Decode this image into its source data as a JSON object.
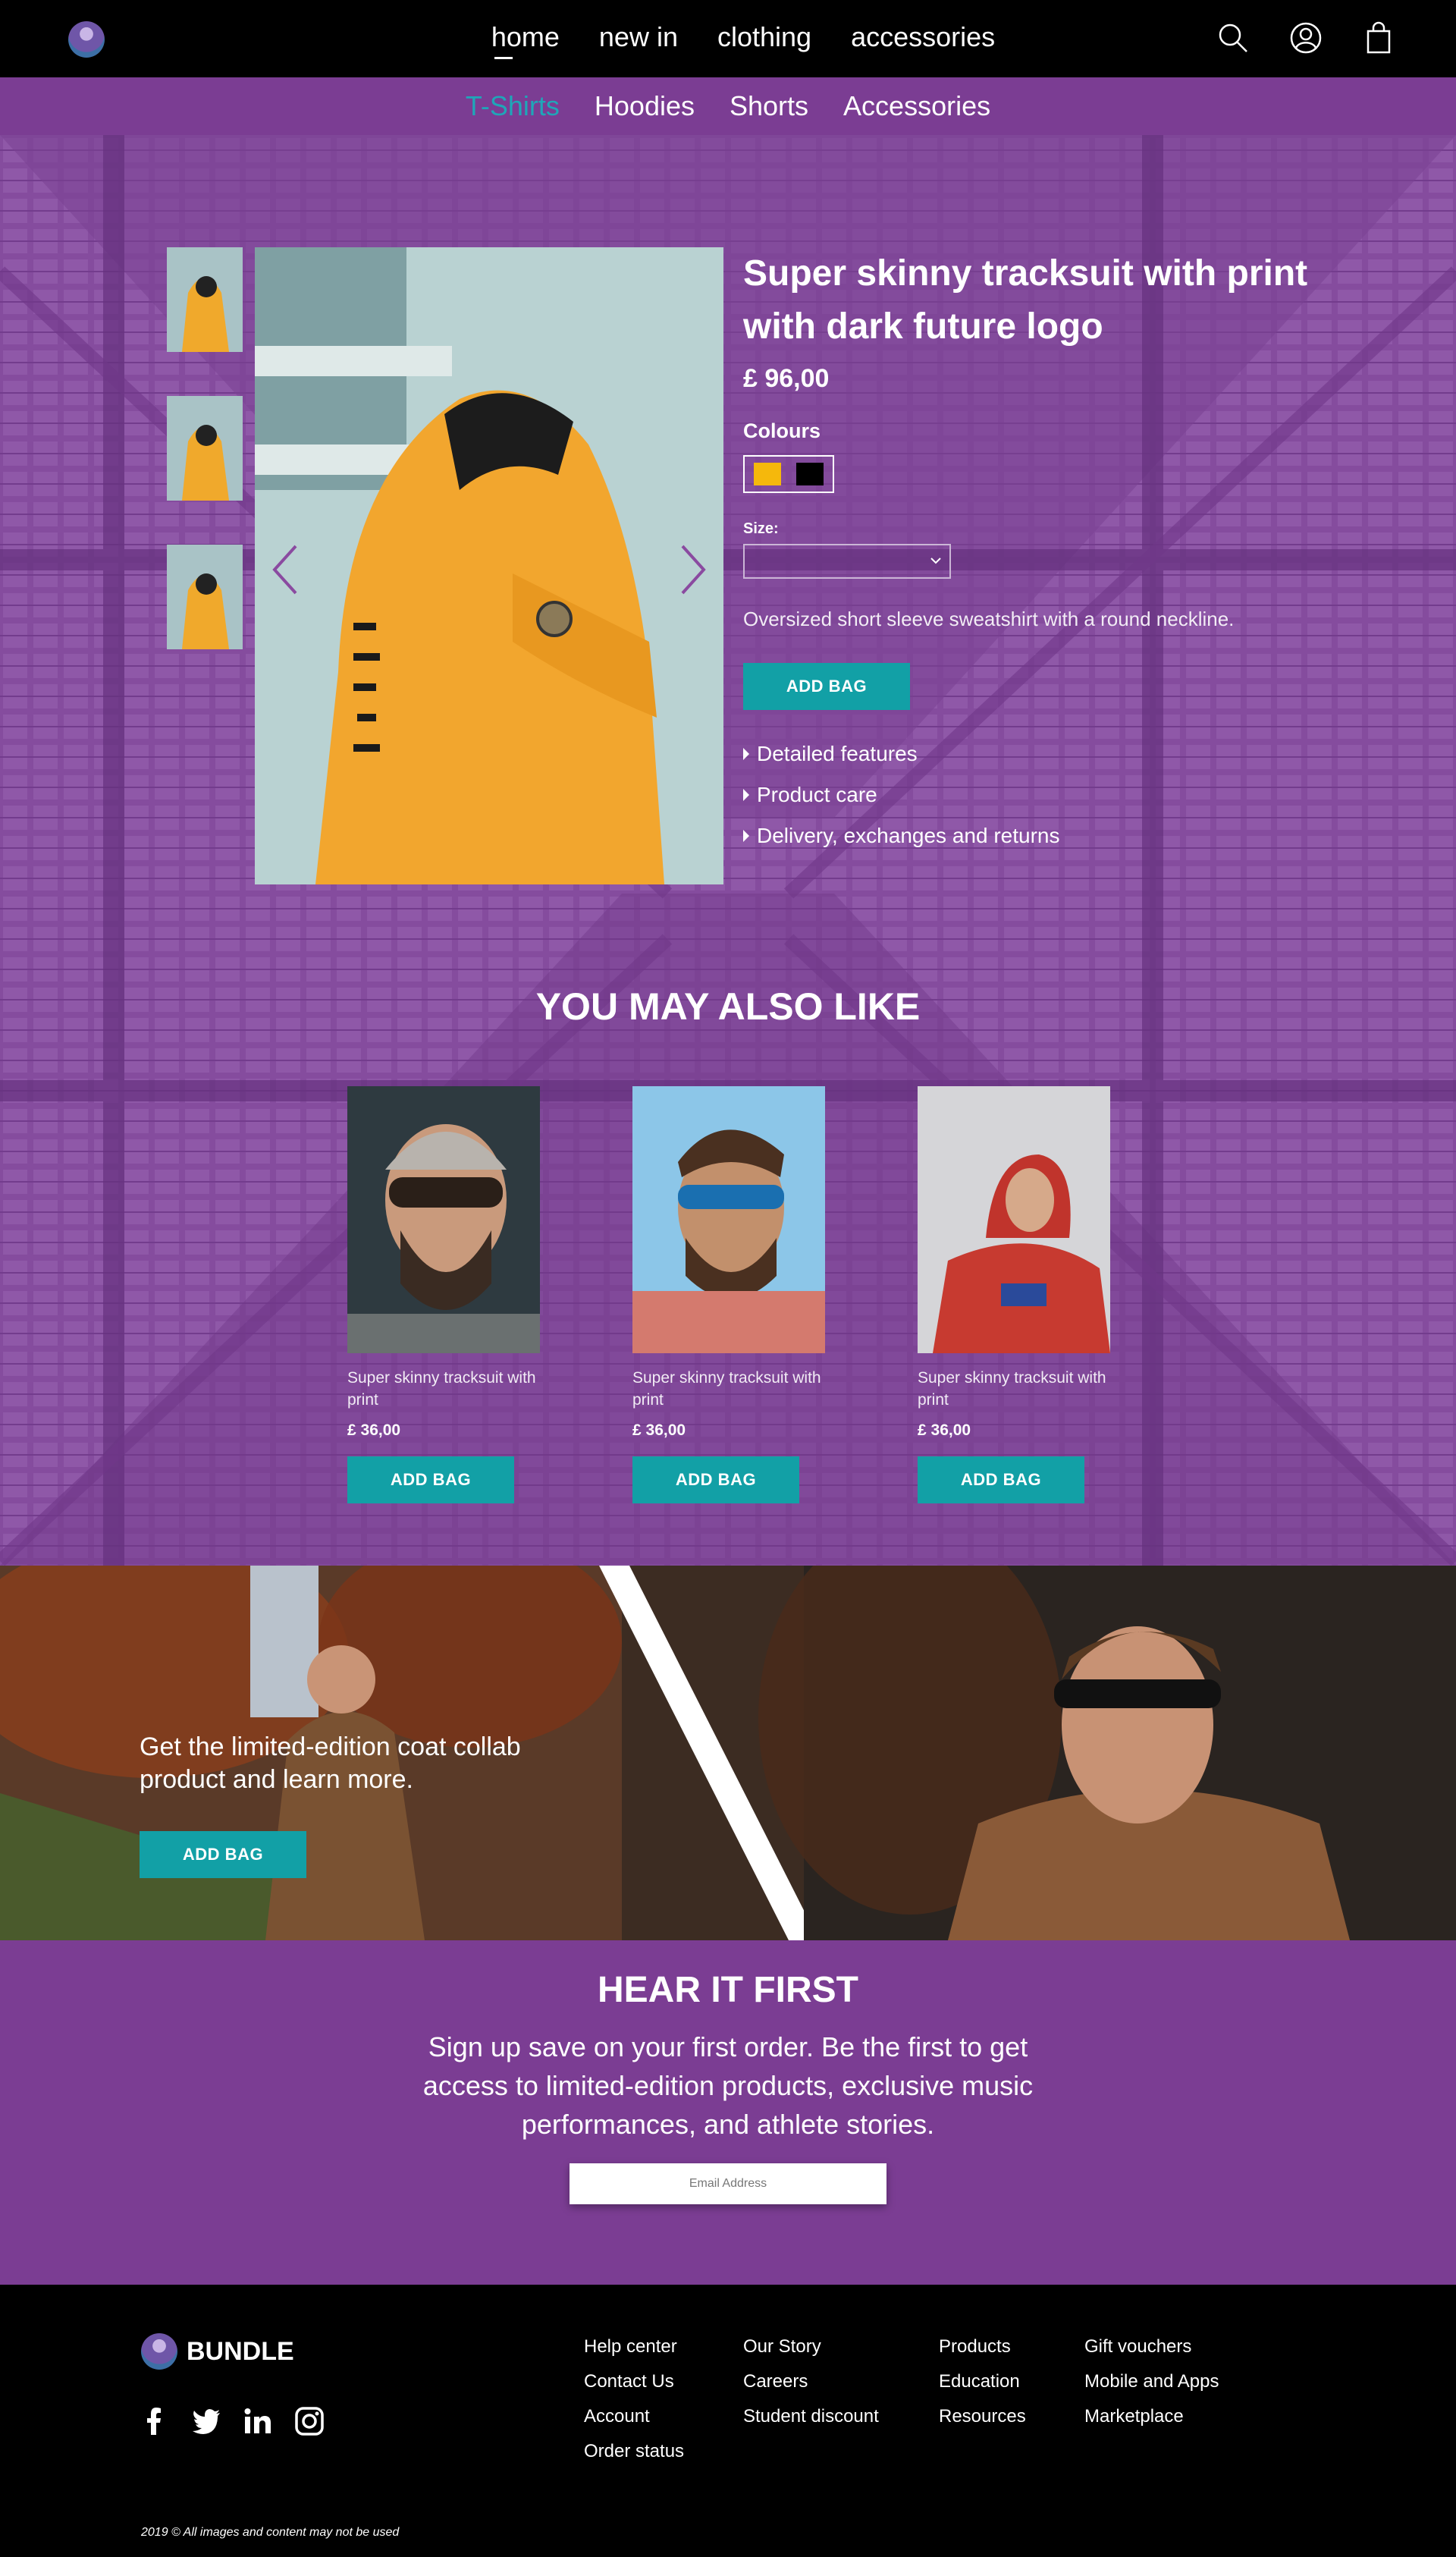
{
  "nav": {
    "links": [
      "home",
      "new in",
      "clothing",
      "accessories"
    ]
  },
  "categories": [
    "T-Shirts",
    "Hoodies",
    "Shorts",
    "Accessories"
  ],
  "product": {
    "title": "Super skinny tracksuit with print with dark future logo",
    "price": "£ 96,00",
    "colours_label": "Colours",
    "colours": [
      "#f5b80c",
      "#000000"
    ],
    "size_label": "Size:",
    "size_value": "",
    "description": "Oversized short sleeve sweatshirt with a round neckline.",
    "add_label": "ADD BAG",
    "features": [
      "Detailed features",
      "Product care",
      "Delivery, exchanges and returns"
    ]
  },
  "also": {
    "title": "YOU MAY ALSO LIKE",
    "items": [
      {
        "name": "Super skinny tracksuit with print",
        "price": "£ 36,00",
        "button": "ADD BAG"
      },
      {
        "name": "Super skinny tracksuit with print",
        "price": "£ 36,00",
        "button": "ADD BAG"
      },
      {
        "name": "Super skinny tracksuit with print",
        "price": "£ 36,00",
        "button": "ADD BAG"
      }
    ]
  },
  "promo": {
    "text": "Get the limited-edition coat collab product and learn more.",
    "button": "ADD BAG"
  },
  "newsletter": {
    "title": "HEAR IT FIRST",
    "text": "Sign up save on your first order. Be the first to get access to limited-edition products, exclusive music performances, and athlete stories.",
    "email_placeholder": "Email Address"
  },
  "footer": {
    "brand": "BUNDLE",
    "col1": [
      "Help center",
      "Contact Us",
      "Account",
      "Order status"
    ],
    "col2": [
      "Our Story",
      "Careers",
      "Student discount"
    ],
    "col3": [
      "Products",
      "Education",
      "Resources"
    ],
    "col4": [
      "Gift vouchers",
      "Mobile and  Apps",
      "Marketplace"
    ],
    "copyright": "2019 © All images and content may not be used"
  },
  "colors": {
    "purple": "#7b3d93",
    "teal": "#12a0a6",
    "active_category": "#1fa6b8"
  }
}
